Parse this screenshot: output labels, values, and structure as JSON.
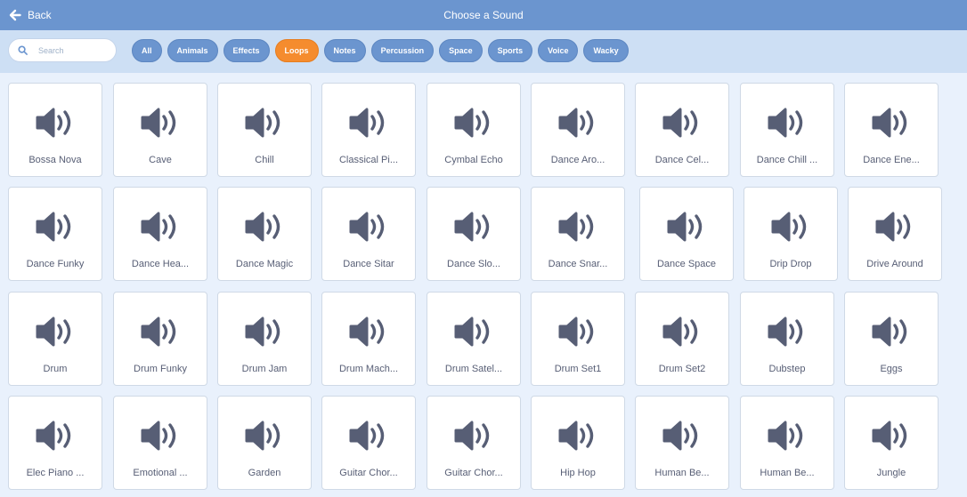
{
  "header": {
    "back_label": "Back",
    "title": "Choose a Sound",
    "back_icon": "arrow-left-icon"
  },
  "search": {
    "placeholder": "Search",
    "value": "",
    "icon": "search-icon"
  },
  "tags": [
    {
      "label": "All",
      "active": false
    },
    {
      "label": "Animals",
      "active": false
    },
    {
      "label": "Effects",
      "active": false
    },
    {
      "label": "Loops",
      "active": true
    },
    {
      "label": "Notes",
      "active": false
    },
    {
      "label": "Percussion",
      "active": false
    },
    {
      "label": "Space",
      "active": false
    },
    {
      "label": "Sports",
      "active": false
    },
    {
      "label": "Voice",
      "active": false
    },
    {
      "label": "Wacky",
      "active": false
    }
  ],
  "colors": {
    "header": "#6b95cf",
    "filter_bar": "#cddff4",
    "tag": "#6b95cf",
    "tag_active": "#f58c2e",
    "background": "#e9f1fc",
    "icon": "#575e75"
  },
  "sound_icon": "speaker-icon",
  "sounds": [
    [
      "Bossa Nova",
      "Cave",
      "Chill",
      "Classical Pi...",
      "Cymbal Echo",
      "Dance Aro...",
      "Dance Cel...",
      "Dance Chill ...",
      "Dance Ene..."
    ],
    [
      "Dance Funky",
      "Dance Hea...",
      "Dance Magic",
      "Dance Sitar",
      "Dance Slo...",
      "Dance Snar...",
      "Dance Space",
      "Drip Drop",
      "Drive Around"
    ],
    [
      "Drum",
      "Drum Funky",
      "Drum Jam",
      "Drum Mach...",
      "Drum Satel...",
      "Drum Set1",
      "Drum Set2",
      "Dubstep",
      "Eggs"
    ],
    [
      "Elec Piano ...",
      "Emotional ...",
      "Garden",
      "Guitar Chor...",
      "Guitar Chor...",
      "Hip Hop",
      "Human Be...",
      "Human Be...",
      "Jungle"
    ]
  ]
}
